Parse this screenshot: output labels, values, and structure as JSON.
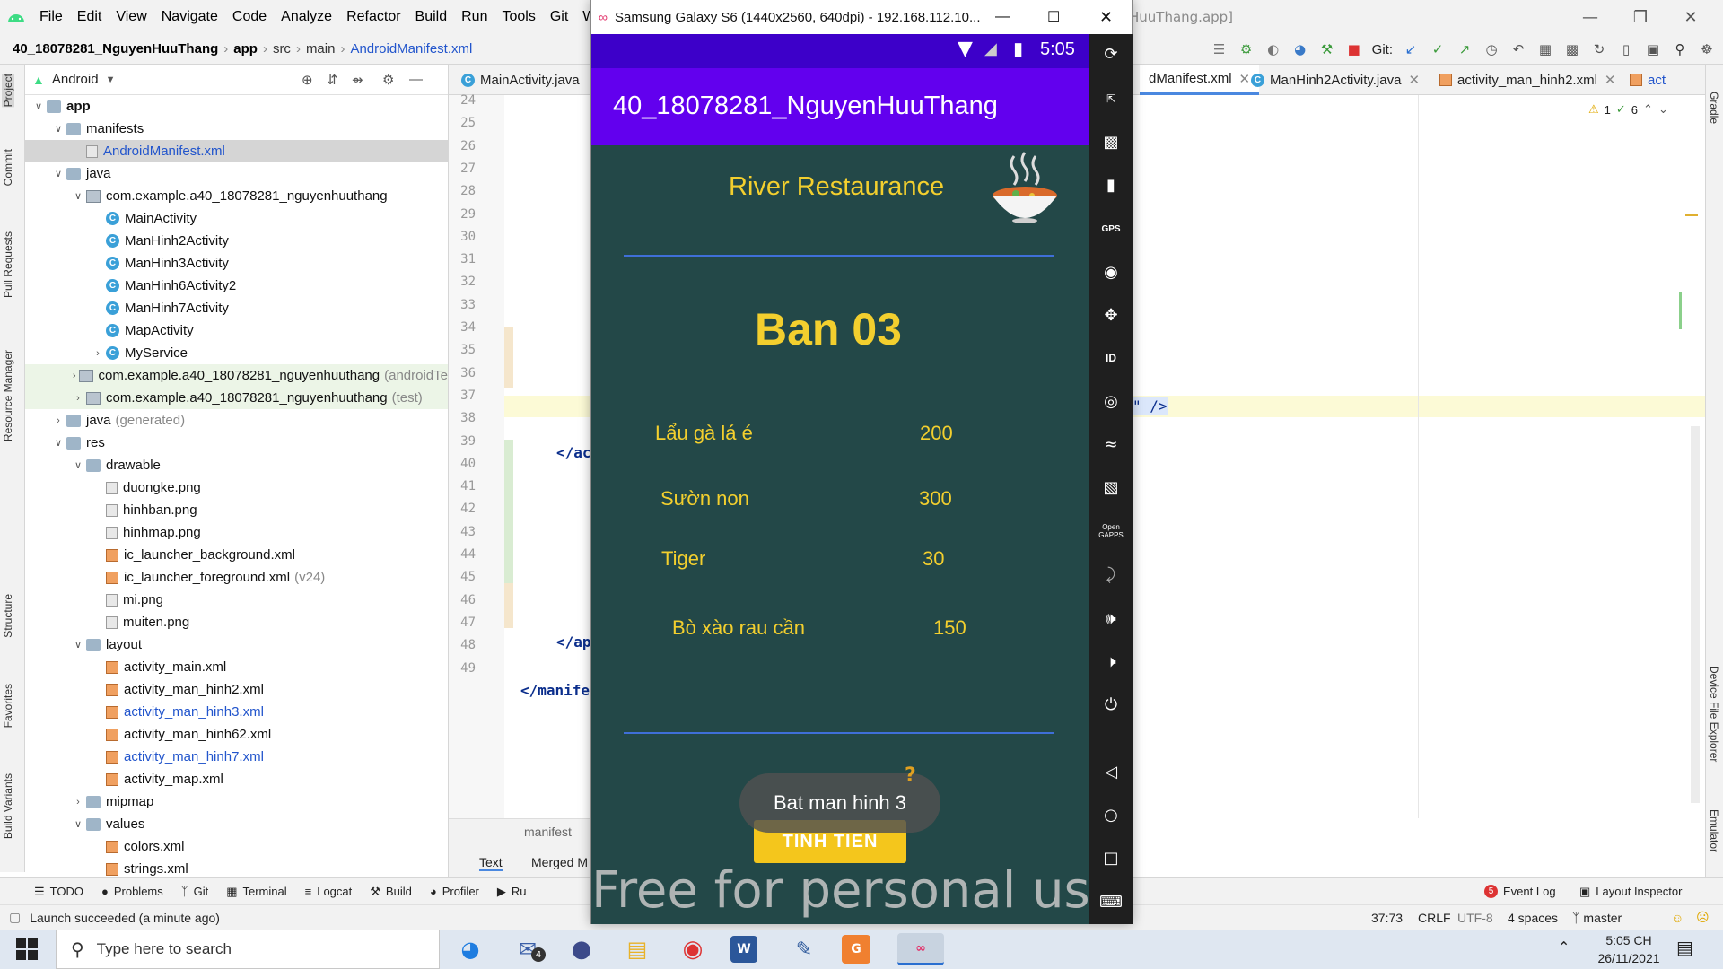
{
  "ide": {
    "menu": [
      "File",
      "Edit",
      "View",
      "Navigate",
      "Code",
      "Analyze",
      "Refactor",
      "Build",
      "Run",
      "Tools",
      "Git",
      "Windo"
    ],
    "window_title_fragment": "HuuThang.app]",
    "breadcrumb": [
      "40_18078281_NguyenHuuThang",
      "app",
      "src",
      "main",
      "AndroidManifest.xml"
    ],
    "git_label": "Git:",
    "project_view": "Android",
    "tree": [
      {
        "label": "app",
        "indent": 0,
        "arrow": "v",
        "icon": "folder",
        "bold": true
      },
      {
        "label": "manifests",
        "indent": 1,
        "arrow": "v",
        "icon": "folder"
      },
      {
        "label": "AndroidManifest.xml",
        "indent": 2,
        "arrow": "",
        "icon": "manifest",
        "style": "sel blue"
      },
      {
        "label": "java",
        "indent": 1,
        "arrow": "v",
        "icon": "folder"
      },
      {
        "label": "com.example.a40_18078281_nguyenhuuthang",
        "indent": 2,
        "arrow": "v",
        "icon": "pkg"
      },
      {
        "label": "MainActivity",
        "indent": 3,
        "arrow": "",
        "icon": "class"
      },
      {
        "label": "ManHinh2Activity",
        "indent": 3,
        "arrow": "",
        "icon": "class"
      },
      {
        "label": "ManHinh3Activity",
        "indent": 3,
        "arrow": "",
        "icon": "class"
      },
      {
        "label": "ManHinh6Activity2",
        "indent": 3,
        "arrow": "",
        "icon": "class"
      },
      {
        "label": "ManHinh7Activity",
        "indent": 3,
        "arrow": "",
        "icon": "class"
      },
      {
        "label": "MapActivity",
        "indent": 3,
        "arrow": "",
        "icon": "class"
      },
      {
        "label": "MyService",
        "indent": 3,
        "arrow": ">",
        "icon": "class"
      },
      {
        "label": "com.example.a40_18078281_nguyenhuuthang",
        "suffix": "(androidTe",
        "indent": 2,
        "arrow": ">",
        "icon": "pkg",
        "style": "green"
      },
      {
        "label": "com.example.a40_18078281_nguyenhuuthang",
        "suffix": "(test)",
        "indent": 2,
        "arrow": ">",
        "icon": "pkg",
        "style": "green"
      },
      {
        "label": "java",
        "suffix": "(generated)",
        "indent": 1,
        "arrow": ">",
        "icon": "folder"
      },
      {
        "label": "res",
        "indent": 1,
        "arrow": "v",
        "icon": "folder"
      },
      {
        "label": "drawable",
        "indent": 2,
        "arrow": "v",
        "icon": "folder"
      },
      {
        "label": "duongke.png",
        "indent": 3,
        "arrow": "",
        "icon": "png"
      },
      {
        "label": "hinhban.png",
        "indent": 3,
        "arrow": "",
        "icon": "png"
      },
      {
        "label": "hinhmap.png",
        "indent": 3,
        "arrow": "",
        "icon": "png"
      },
      {
        "label": "ic_launcher_background.xml",
        "indent": 3,
        "arrow": "",
        "icon": "xml"
      },
      {
        "label": "ic_launcher_foreground.xml",
        "suffix": "(v24)",
        "indent": 3,
        "arrow": "",
        "icon": "xml"
      },
      {
        "label": "mi.png",
        "indent": 3,
        "arrow": "",
        "icon": "png"
      },
      {
        "label": "muiten.png",
        "indent": 3,
        "arrow": "",
        "icon": "png"
      },
      {
        "label": "layout",
        "indent": 2,
        "arrow": "v",
        "icon": "folder"
      },
      {
        "label": "activity_main.xml",
        "indent": 3,
        "arrow": "",
        "icon": "xml"
      },
      {
        "label": "activity_man_hinh2.xml",
        "indent": 3,
        "arrow": "",
        "icon": "xml"
      },
      {
        "label": "activity_man_hinh3.xml",
        "indent": 3,
        "arrow": "",
        "icon": "xml",
        "style": "blue"
      },
      {
        "label": "activity_man_hinh62.xml",
        "indent": 3,
        "arrow": "",
        "icon": "xml"
      },
      {
        "label": "activity_man_hinh7.xml",
        "indent": 3,
        "arrow": "",
        "icon": "xml",
        "style": "blue"
      },
      {
        "label": "activity_map.xml",
        "indent": 3,
        "arrow": "",
        "icon": "xml"
      },
      {
        "label": "mipmap",
        "indent": 2,
        "arrow": ">",
        "icon": "folder"
      },
      {
        "label": "values",
        "indent": 2,
        "arrow": "v",
        "icon": "folder"
      },
      {
        "label": "colors.xml",
        "indent": 3,
        "arrow": "",
        "icon": "xml"
      },
      {
        "label": "strings.xml",
        "indent": 3,
        "arrow": "",
        "icon": "xml"
      }
    ],
    "editor_tabs": [
      "MainActivity.java",
      "dManifest.xml",
      "ManHinh2Activity.java",
      "activity_man_hinh2.xml",
      "act"
    ],
    "line_numbers": [
      "24",
      "25",
      "26",
      "27",
      "28",
      "29",
      "30",
      "31",
      "32",
      "33",
      "34",
      "35",
      "36",
      "37",
      "38",
      "39",
      "40",
      "41",
      "42",
      "43",
      "44",
      "45",
      "46",
      "47",
      "48",
      "49"
    ],
    "code_fragments": {
      "l39": "</ac",
      "l47": "</ap",
      "l49": "</manife",
      "l37_tail": "\" />"
    },
    "inspections": {
      "warnings": "1",
      "ok": "6"
    },
    "bottom_subtabs": {
      "crumb": "manifest",
      "text": "Text",
      "merged": "Merged M"
    },
    "left_tools": [
      "Project",
      "Commit",
      "Pull Requests",
      "Resource Manager",
      "Structure",
      "Favorites",
      "Build Variants"
    ],
    "right_tools": [
      "Gradle",
      "Device File Explorer",
      "Emulator"
    ],
    "bottom_tools": [
      "TODO",
      "Problems",
      "Git",
      "Terminal",
      "Logcat",
      "Build",
      "Profiler",
      "Ru"
    ],
    "bottom_right_tools": {
      "event_log": "Event Log",
      "event_count": "5",
      "layout_inspector": "Layout Inspector"
    },
    "status": {
      "message": "Launch succeeded (a minute ago)",
      "position": "37:73",
      "line_sep": "CRLF",
      "encoding": "UTF-8",
      "indent": "4 spaces",
      "branch": "master"
    }
  },
  "emulator": {
    "title": "Samsung Galaxy S6 (1440x2560, 640dpi) - 192.168.112.10...",
    "time": "5:05",
    "app_title": "40_18078281_NguyenHuuThang",
    "restaurant": "River Restaurance",
    "table": "Ban 03",
    "items": [
      {
        "name": "Lẩu gà lá é",
        "price": "200"
      },
      {
        "name": "Sườn non",
        "price": "300"
      },
      {
        "name": "Tiger",
        "price": "30"
      },
      {
        "name": "Bò xào rau cần",
        "price": "150"
      }
    ],
    "button": "TINH TIEN",
    "toast": "Bat man hinh 3",
    "toast_hint": "?",
    "watermark": "Free for personal use",
    "side_buttons": [
      "rotate-icon",
      "one-to-one-icon",
      "camera-shutter-icon",
      "battery-icon",
      "gps-icon",
      "camera-icon",
      "move-icon",
      "id-icon",
      "fingerprint-icon",
      "cast-icon",
      "message-icon",
      "open-gapps-icon",
      "share-icon",
      "volume-up-icon",
      "volume-down-icon",
      "power-icon",
      "back-icon",
      "home-icon",
      "recents-icon",
      "keyboard-icon"
    ],
    "open_gapps": "Open GAPPS",
    "id_label": "ID",
    "gps_label": "GPS"
  },
  "taskbar": {
    "search_placeholder": "Type here to search",
    "time": "5:05 CH",
    "date": "26/11/2021",
    "mail_badge": "4"
  }
}
